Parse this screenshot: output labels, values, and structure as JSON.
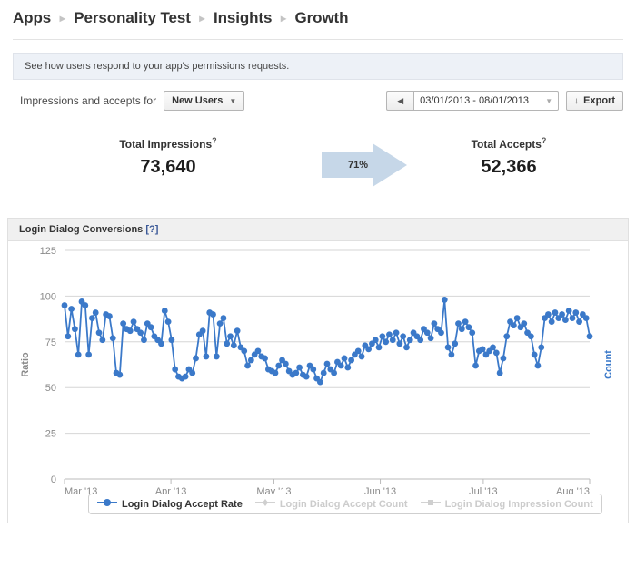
{
  "breadcrumb": {
    "items": [
      "Apps",
      "Personality Test",
      "Insights",
      "Growth"
    ],
    "separator": "▸"
  },
  "info_banner": {
    "text": "See how users respond to your app's permissions requests."
  },
  "controls": {
    "label": "Impressions and accepts for",
    "audience_select": {
      "value": "New Users",
      "caret": "▼"
    },
    "date_prev_icon": "◀",
    "date_range": {
      "value": "03/01/2013 - 08/01/2013",
      "caret": "▼"
    },
    "export": {
      "label": "Export",
      "icon": "↓"
    }
  },
  "metrics": {
    "impressions": {
      "title": "Total Impressions",
      "help": "?",
      "value": "73,640"
    },
    "conversion": {
      "percent": "71%"
    },
    "accepts": {
      "title": "Total Accepts",
      "help": "?",
      "value": "52,366"
    }
  },
  "chart_panel": {
    "title": "Login Dialog Conversions",
    "help": "[?]"
  },
  "legend": {
    "items": [
      {
        "label": "Login Dialog Accept Rate",
        "active": true,
        "color": "#3b79c9",
        "symbol": "line-marker"
      },
      {
        "label": "Login Dialog Accept Count",
        "active": false,
        "color": "#cccccc",
        "symbol": "line-marker"
      },
      {
        "label": "Login Dialog Impression Count",
        "active": false,
        "color": "#cccccc",
        "symbol": "line-square"
      }
    ]
  },
  "colors": {
    "series_blue": "#3b79c9",
    "grid": "#d6d6d6",
    "axis_text": "#8a8a8a",
    "right_axis_label": "#3b79c9",
    "arrow_fill": "#c6d7e8",
    "banner_bg": "#edf1f7",
    "panel_head_bg": "#f0f0f0"
  },
  "chart_data": {
    "type": "line",
    "title": "Login Dialog Conversions",
    "xlabel": "",
    "ylabel": "Ratio",
    "y2label": "Count",
    "ylim": [
      0,
      125
    ],
    "yticks": [
      0,
      25,
      50,
      75,
      100,
      125
    ],
    "grid": true,
    "legend_position": "bottom",
    "xticks": [
      "Mar '13",
      "Apr '13",
      "May '13",
      "Jun '13",
      "Jul '13",
      "Aug '13"
    ],
    "xtick_positions": [
      0,
      31,
      61,
      92,
      122,
      153
    ],
    "x_range": [
      0,
      153
    ],
    "series": [
      {
        "name": "Login Dialog Accept Rate",
        "color": "#3b79c9",
        "unit": "%",
        "values": [
          95,
          78,
          93,
          82,
          68,
          97,
          95,
          68,
          88,
          91,
          80,
          76,
          90,
          89,
          77,
          58,
          57,
          85,
          82,
          81,
          86,
          82,
          80,
          76,
          85,
          83,
          78,
          76,
          74,
          92,
          86,
          76,
          60,
          56,
          55,
          56,
          60,
          58,
          66,
          79,
          81,
          67,
          91,
          90,
          67,
          85,
          88,
          74,
          78,
          73,
          81,
          72,
          70,
          62,
          65,
          68,
          70,
          67,
          66,
          60,
          59,
          58,
          62,
          65,
          63,
          59,
          57,
          58,
          61,
          57,
          56,
          62,
          60,
          55,
          53,
          58,
          63,
          60,
          58,
          64,
          62,
          66,
          61,
          65,
          68,
          70,
          67,
          73,
          71,
          74,
          76,
          72,
          78,
          75,
          79,
          76,
          80,
          74,
          78,
          72,
          76,
          80,
          78,
          76,
          82,
          80,
          77,
          85,
          82,
          80,
          98,
          72,
          68,
          74,
          85,
          82,
          86,
          83,
          80,
          62,
          70,
          71,
          68,
          70,
          72,
          69,
          58,
          66,
          78,
          86,
          84,
          88,
          83,
          85,
          80,
          78,
          68,
          62,
          72,
          88,
          90,
          86,
          91,
          88,
          90,
          87,
          92,
          88,
          91,
          86,
          90,
          88,
          78
        ]
      }
    ]
  }
}
